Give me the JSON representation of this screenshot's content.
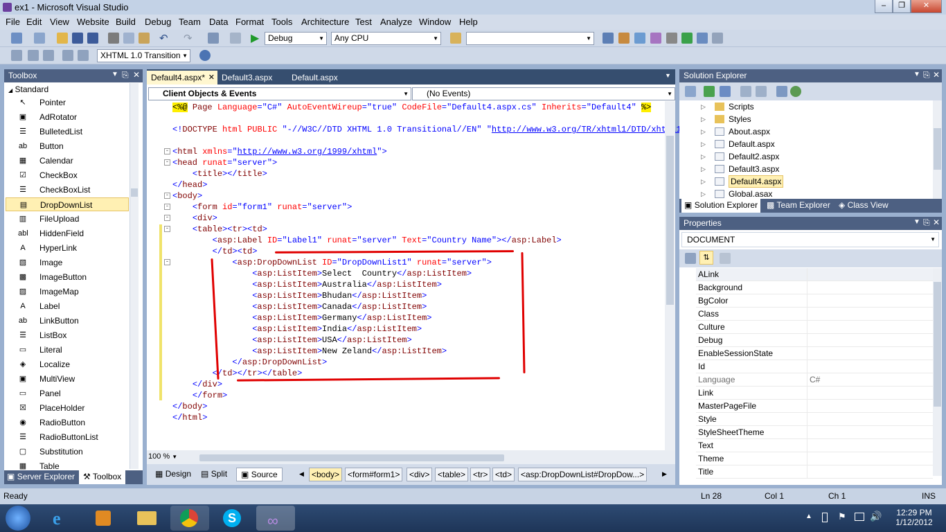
{
  "window": {
    "title": "ex1 - Microsoft Visual Studio"
  },
  "menu": [
    "File",
    "Edit",
    "View",
    "Website",
    "Build",
    "Debug",
    "Team",
    "Data",
    "Format",
    "Tools",
    "Architecture",
    "Test",
    "Analyze",
    "Window",
    "Help"
  ],
  "toolbar": {
    "config": "Debug",
    "platform": "Any CPU",
    "find": "",
    "doctype": "XHTML 1.0 Transition"
  },
  "toolbox": {
    "title": "Toolbox",
    "group": "Standard",
    "items": [
      "Pointer",
      "AdRotator",
      "BulletedList",
      "Button",
      "Calendar",
      "CheckBox",
      "CheckBoxList",
      "DropDownList",
      "FileUpload",
      "HiddenField",
      "HyperLink",
      "Image",
      "ImageButton",
      "ImageMap",
      "Label",
      "LinkButton",
      "ListBox",
      "Literal",
      "Localize",
      "MultiView",
      "Panel",
      "PlaceHolder",
      "RadioButton",
      "RadioButtonList",
      "Substitution",
      "Table"
    ],
    "selected": "DropDownList",
    "tab_server": "Server Explorer",
    "tab_toolbox": "Toolbox"
  },
  "editor": {
    "tabs": [
      "Default4.aspx*",
      "Default3.aspx",
      "Default.aspx"
    ],
    "active_tab": "Default4.aspx*",
    "objects_combo": "Client Objects & Events",
    "events_combo": "(No Events)",
    "zoom": "100 %",
    "view_design": "Design",
    "view_split": "Split",
    "view_source": "Source",
    "breadcrumbs": [
      "<body>",
      "<form#form1>",
      "<div>",
      "<table>",
      "<tr>",
      "<td>",
      "<asp:DropDownList#DropDow...>"
    ]
  },
  "solution_explorer": {
    "title": "Solution Explorer",
    "items": [
      "Scripts",
      "Styles",
      "About.aspx",
      "Default.aspx",
      "Default2.aspx",
      "Default3.aspx",
      "Default4.aspx",
      "Global.asax"
    ],
    "selected": "Default4.aspx",
    "tabs": [
      "Solution Explorer",
      "Team Explorer",
      "Class View"
    ]
  },
  "properties": {
    "title": "Properties",
    "object": "DOCUMENT",
    "rows": [
      {
        "name": "ALink",
        "value": ""
      },
      {
        "name": "Background",
        "value": ""
      },
      {
        "name": "BgColor",
        "value": ""
      },
      {
        "name": "Class",
        "value": ""
      },
      {
        "name": "Culture",
        "value": ""
      },
      {
        "name": "Debug",
        "value": ""
      },
      {
        "name": "EnableSessionState",
        "value": ""
      },
      {
        "name": "Id",
        "value": ""
      },
      {
        "name": "Language",
        "value": "C#"
      },
      {
        "name": "Link",
        "value": ""
      },
      {
        "name": "MasterPageFile",
        "value": ""
      },
      {
        "name": "Style",
        "value": ""
      },
      {
        "name": "StyleSheetTheme",
        "value": ""
      },
      {
        "name": "Text",
        "value": ""
      },
      {
        "name": "Theme",
        "value": ""
      },
      {
        "name": "Title",
        "value": ""
      }
    ]
  },
  "status": {
    "left": "Ready",
    "ln": "Ln 28",
    "col": "Col 1",
    "ch": "Ch 1",
    "mode": "INS"
  },
  "clock": {
    "time": "12:29 PM",
    "date": "1/12/2012"
  },
  "colors": {
    "accent": "#4d6082",
    "selection": "#fff0b3",
    "annotation": "#e00000"
  }
}
